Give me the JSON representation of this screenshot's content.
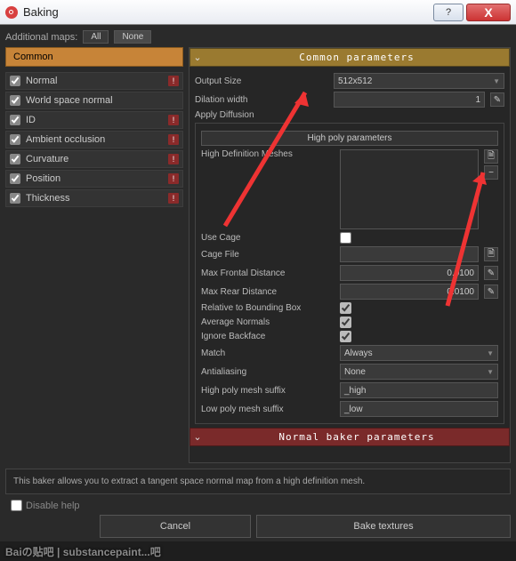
{
  "window": {
    "title": "Baking",
    "help_glyph": "?",
    "close_glyph": "X"
  },
  "top": {
    "label": "Additional maps:",
    "all": "All",
    "none": "None"
  },
  "sidebar": {
    "tab": "Common",
    "items": [
      {
        "name": "Normal",
        "warn": true
      },
      {
        "name": "World space normal",
        "warn": false
      },
      {
        "name": "ID",
        "warn": true
      },
      {
        "name": "Ambient occlusion",
        "warn": true
      },
      {
        "name": "Curvature",
        "warn": true
      },
      {
        "name": "Position",
        "warn": true
      },
      {
        "name": "Thickness",
        "warn": true
      }
    ]
  },
  "sections": {
    "common": "Common parameters",
    "high_poly_sub": "High poly parameters",
    "normal": "Normal baker parameters"
  },
  "params": {
    "output_size_label": "Output Size",
    "output_size_value": "512x512",
    "dilation_label": "Dilation width",
    "dilation_value": "1",
    "apply_diffusion_label": "Apply Diffusion",
    "hd_meshes_label": "High Definition Meshes",
    "use_cage_label": "Use Cage",
    "cage_file_label": "Cage File",
    "cage_file_value": "",
    "max_frontal_label": "Max Frontal Distance",
    "max_frontal_value": "0.0100",
    "max_rear_label": "Max Rear Distance",
    "max_rear_value": "0.0100",
    "rel_bbox_label": "Relative to Bounding Box",
    "avg_normals_label": "Average Normals",
    "ignore_backface_label": "Ignore Backface",
    "match_label": "Match",
    "match_value": "Always",
    "antialias_label": "Antialiasing",
    "antialias_value": "None",
    "hp_suffix_label": "High poly mesh suffix",
    "hp_suffix_value": "_high",
    "lp_suffix_label": "Low poly mesh suffix",
    "lp_suffix_value": "_low"
  },
  "help": {
    "text": "This baker allows you to extract a tangent space normal map from a high definition mesh.",
    "disable": "Disable help"
  },
  "buttons": {
    "cancel": "Cancel",
    "bake": "Bake textures"
  },
  "watermark": "Baiの贴吧 | substancepaint...吧"
}
